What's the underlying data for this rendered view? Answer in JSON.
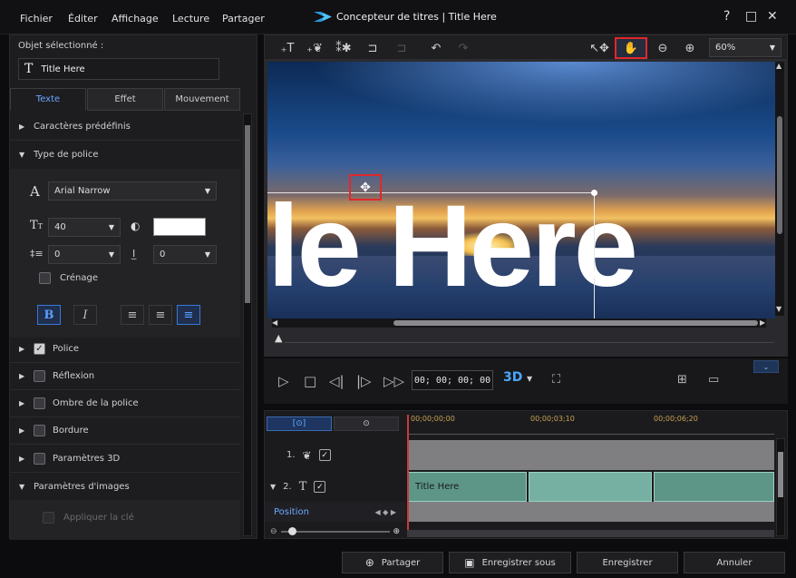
{
  "menu": [
    "Fichier",
    "Éditer",
    "Affichage",
    "Lecture",
    "Partager"
  ],
  "title": "Concepteur de titres  |  Title Here",
  "window_controls": {
    "help": "?",
    "maximize": "□",
    "close": "✕"
  },
  "left": {
    "selected_label": "Objet sélectionné :",
    "selected_value": "Title Here",
    "tabs": [
      "Texte",
      "Effet",
      "Mouvement"
    ],
    "sections": {
      "presets": "Caractères prédéfinis",
      "font_type": "Type de police",
      "font": "Police",
      "reflection": "Réflexion",
      "shadow": "Ombre de la police",
      "border": "Bordure",
      "params3d": "Paramètres 3D",
      "image_params": "Paramètres d'images",
      "apply_key": "Appliquer la clé"
    },
    "font_name": "Arial Narrow",
    "font_size": "40",
    "line_spacing": "0",
    "char_spacing": "0",
    "kerning_label": "Crénage",
    "bold": "B",
    "italic": "I",
    "font_color": "#ffffff"
  },
  "toolbar": {
    "zoom": "60%",
    "active_tool": "hand-icon"
  },
  "preview": {
    "overlay_text": "le Here"
  },
  "transport": {
    "timecode": "00; 00; 00; 00",
    "mode3d": "3D"
  },
  "timeline": {
    "ruler": [
      "00;00;00;00",
      "00;00;03;10",
      "00;00;06;20"
    ],
    "track1": "1.",
    "track2": "2.",
    "clip_label": "Title Here",
    "position_label": "Position"
  },
  "buttons": {
    "share": "Partager",
    "save_as": "Enregistrer sous",
    "save": "Enregistrer",
    "cancel": "Annuler"
  }
}
